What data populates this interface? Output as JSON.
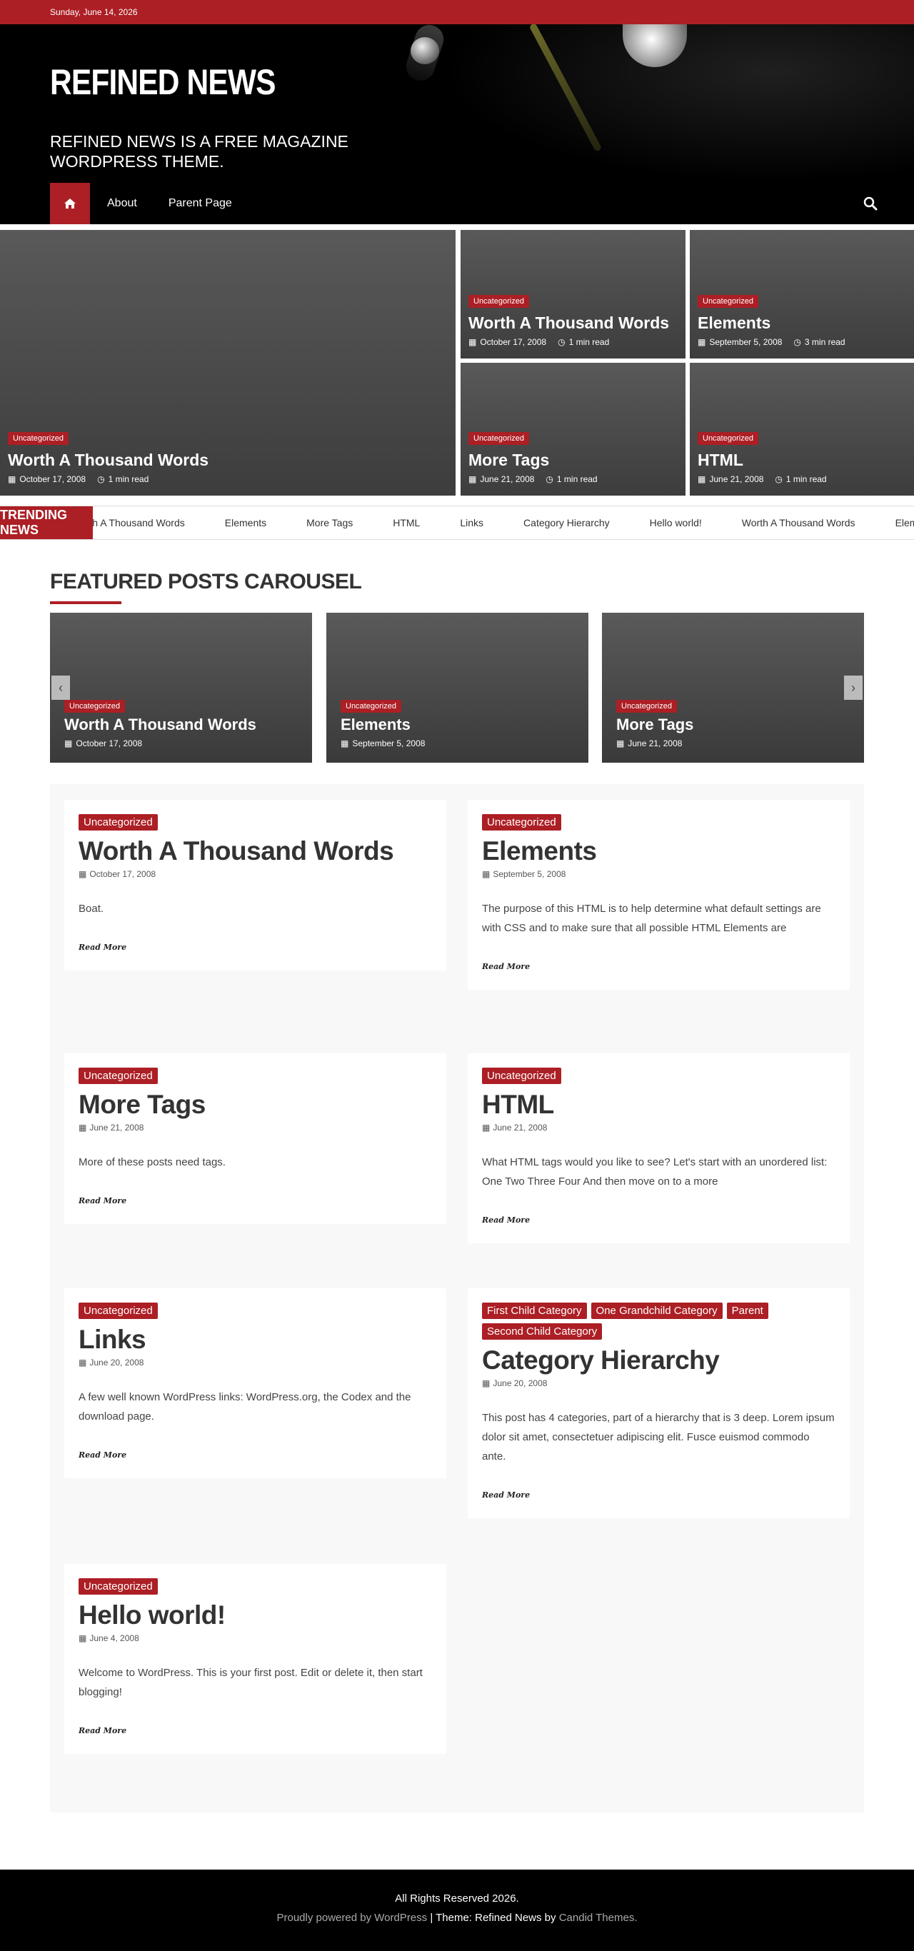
{
  "topbar": {
    "date": "Sunday, June 14, 2026"
  },
  "header": {
    "site_title": "REFINED NEWS",
    "tagline": "REFINED NEWS IS A FREE MAGAZINE WORDPRESS THEME."
  },
  "nav": {
    "items": [
      "About",
      "Parent Page"
    ]
  },
  "featured_grid": [
    {
      "category": "Uncategorized",
      "title": "Worth A Thousand Words",
      "date": "October 17, 2008",
      "read": "1 min read"
    },
    {
      "category": "Uncategorized",
      "title": "Worth A Thousand Words",
      "date": "October 17, 2008",
      "read": "1 min read"
    },
    {
      "category": "Uncategorized",
      "title": "Elements",
      "date": "September 5, 2008",
      "read": "3 min read"
    },
    {
      "category": "Uncategorized",
      "title": "More Tags",
      "date": "June 21, 2008",
      "read": "1 min read"
    },
    {
      "category": "Uncategorized",
      "title": "HTML",
      "date": "June 21, 2008",
      "read": "1 min read"
    }
  ],
  "trending": {
    "label": "TRENDING NEWS",
    "items": [
      "Worth A Thousand Words",
      "Elements",
      "More Tags",
      "HTML",
      "Links",
      "Category Hierarchy",
      "Hello world!",
      "Worth A Thousand Words",
      "Elements"
    ]
  },
  "carousel": {
    "title": "FEATURED POSTS CAROUSEL",
    "items": [
      {
        "category": "Uncategorized",
        "title": "Worth A Thousand Words",
        "date": "October 17, 2008"
      },
      {
        "category": "Uncategorized",
        "title": "Elements",
        "date": "September 5, 2008"
      },
      {
        "category": "Uncategorized",
        "title": "More Tags",
        "date": "June 21, 2008"
      }
    ]
  },
  "posts": [
    {
      "categories": [
        "Uncategorized"
      ],
      "title": "Worth A Thousand Words",
      "date": "October 17, 2008",
      "excerpt": "Boat.",
      "more": "Read More"
    },
    {
      "categories": [
        "Uncategorized"
      ],
      "title": "Elements",
      "date": "September 5, 2008",
      "excerpt": "The purpose of this HTML is to help determine what default settings are with CSS and to make sure that all possible HTML Elements are",
      "more": "Read More"
    },
    {
      "categories": [
        "Uncategorized"
      ],
      "title": "More Tags",
      "date": "June 21, 2008",
      "excerpt": "More of these posts need tags.",
      "more": "Read More"
    },
    {
      "categories": [
        "Uncategorized"
      ],
      "title": "HTML",
      "date": "June 21, 2008",
      "excerpt": "What HTML tags would you like to see? Let's start with an unordered list: One Two Three Four And then move on to a more",
      "more": "Read More"
    },
    {
      "categories": [
        "Uncategorized"
      ],
      "title": "Links",
      "date": "June 20, 2008",
      "excerpt": "A few well known WordPress links: WordPress.org, the Codex and the download page.",
      "more": "Read More"
    },
    {
      "categories": [
        "First Child Category",
        "One Grandchild Category",
        "Parent",
        "Second Child Category"
      ],
      "title": "Category Hierarchy",
      "date": "June 20, 2008",
      "excerpt": "This post has 4 categories, part of a hierarchy that is 3 deep. Lorem ipsum dolor sit amet, consectetuer adipiscing elit. Fusce euismod commodo ante.",
      "more": "Read More"
    },
    {
      "categories": [
        "Uncategorized"
      ],
      "title": "Hello world!",
      "date": "June 4, 2008",
      "excerpt": "Welcome to WordPress. This is your first post. Edit or delete it, then start blogging!",
      "more": "Read More"
    }
  ],
  "footer": {
    "copyright": "All Rights Reserved 2026.",
    "powered_prefix": "Proudly powered by WordPress",
    "theme_text": " | Theme: Refined News by ",
    "theme_author": "Candid Themes",
    "period": "."
  },
  "colors": {
    "accent": "#ac1f25",
    "dark": "#000000"
  }
}
